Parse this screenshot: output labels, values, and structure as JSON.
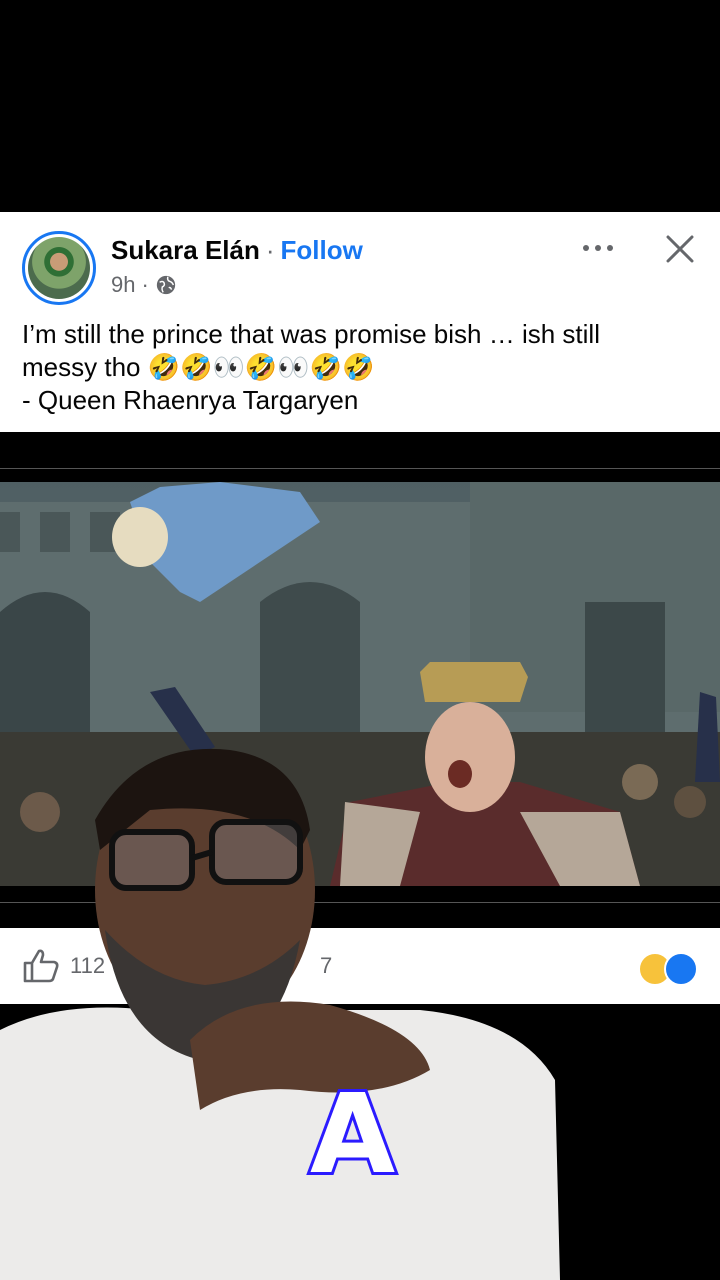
{
  "post": {
    "author": "Sukara Elán",
    "separator": "·",
    "follow_label": "Follow",
    "time": "9h",
    "meta_separator": "·",
    "text_lines": [
      "I’m still the prince that was promise bish … ish still",
      "messy tho 🤣🤣👀🤣👀🤣🤣",
      "- Queen Rhaenrya Targaryen"
    ]
  },
  "reactions": {
    "like_count": "112",
    "comment_count": "7"
  },
  "overlay": {
    "caption_letter": "A"
  },
  "colors": {
    "accent": "#1877f2",
    "caption_stroke": "#2b1bff"
  },
  "icons": {
    "more": "more-dots-icon",
    "close": "close-icon",
    "globe": "globe-icon",
    "like": "thumbs-up-icon"
  }
}
